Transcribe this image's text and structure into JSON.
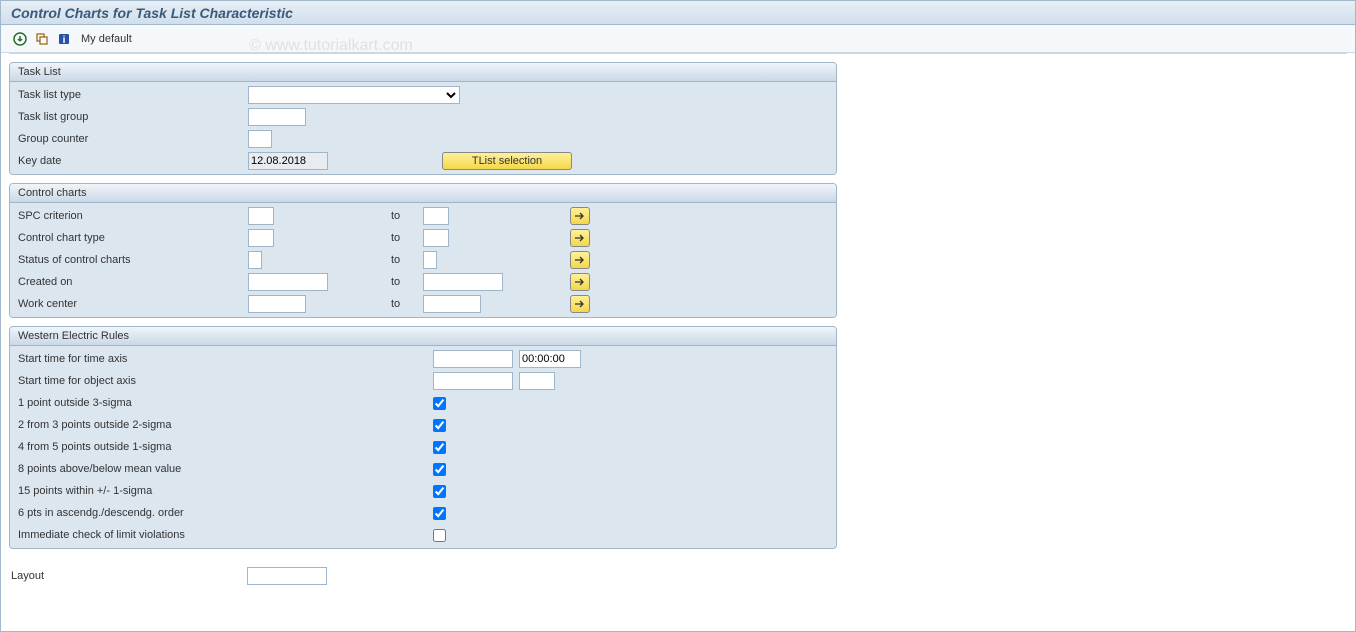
{
  "header": {
    "title": "Control Charts for Task List Characteristic"
  },
  "toolbar": {
    "my_default": "My default"
  },
  "watermark": "© www.tutorialkart.com",
  "groups": {
    "task_list": {
      "title": "Task List",
      "fields": {
        "type_label": "Task list type",
        "type_value": "",
        "group_label": "Task list group",
        "group_value": "",
        "counter_label": "Group counter",
        "counter_value": "",
        "keydate_label": "Key date",
        "keydate_value": "12.08.2018",
        "tlist_button": "TList selection"
      }
    },
    "control_charts": {
      "title": "Control charts",
      "to_label": "to",
      "fields": {
        "spc_label": "SPC criterion",
        "cctype_label": "Control chart type",
        "status_label": "Status of control charts",
        "created_label": "Created on",
        "workcenter_label": "Work center"
      }
    },
    "wer": {
      "title": "Western Electric Rules",
      "fields": {
        "start_time_axis_label": "Start time for time axis",
        "start_time_axis_time": "00:00:00",
        "start_obj_axis_label": "Start time for object axis",
        "r1": "1 point outside 3-sigma",
        "r2": "2 from 3 points outside 2-sigma",
        "r3": "4 from 5 points outside 1-sigma",
        "r4": "8 points above/below mean value",
        "r5": "15 points within +/- 1-sigma",
        "r6": "6 pts in ascendg./descendg. order",
        "r7": "Immediate check of limit violations",
        "r1_checked": true,
        "r2_checked": true,
        "r3_checked": true,
        "r4_checked": true,
        "r5_checked": true,
        "r6_checked": true,
        "r7_checked": false
      }
    }
  },
  "layout": {
    "label": "Layout",
    "value": ""
  }
}
